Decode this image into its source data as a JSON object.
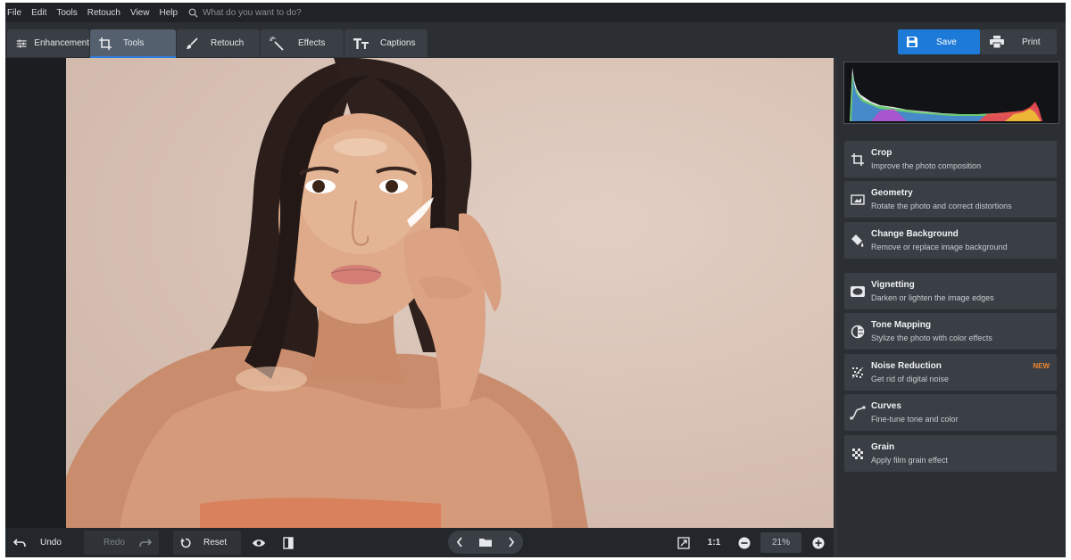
{
  "menu": {
    "items": [
      "File",
      "Edit",
      "Tools",
      "Retouch",
      "View",
      "Help"
    ],
    "search_placeholder": "What do you want to do?"
  },
  "toolbar": {
    "tabs": [
      {
        "label": "Enhancement",
        "icon": "sliders-icon"
      },
      {
        "label": "Tools",
        "icon": "crop-icon",
        "active": true
      },
      {
        "label": "Retouch",
        "icon": "brush-icon"
      },
      {
        "label": "Effects",
        "icon": "magic-wand-icon"
      },
      {
        "label": "Captions",
        "icon": "text-icon"
      }
    ],
    "save_label": "Save",
    "print_label": "Print"
  },
  "tools": [
    {
      "title": "Crop",
      "desc": "Improve the photo composition",
      "icon": "crop-icon"
    },
    {
      "title": "Geometry",
      "desc": "Rotate the photo and correct distortions",
      "icon": "geometry-icon"
    },
    {
      "title": "Change Background",
      "desc": "Remove or replace image background",
      "icon": "paint-bucket-icon"
    },
    {
      "title": "Vignetting",
      "desc": "Darken or lighten the image edges",
      "icon": "vignette-icon"
    },
    {
      "title": "Tone Mapping",
      "desc": "Stylize the photo with color effects",
      "icon": "tone-mapping-icon"
    },
    {
      "title": "Noise Reduction",
      "desc": "Get rid of digital noise",
      "icon": "noise-icon",
      "badge": "NEW"
    },
    {
      "title": "Curves",
      "desc": "Fine-tune tone and color",
      "icon": "curves-icon"
    },
    {
      "title": "Grain",
      "desc": "Apply film grain effect",
      "icon": "grain-icon"
    }
  ],
  "bottom": {
    "undo_label": "Undo",
    "redo_label": "Redo",
    "reset_label": "Reset",
    "ratio_label": "1:1",
    "zoom_value": "21%"
  },
  "colors": {
    "accent": "#1d7ad8",
    "badge": "#f0862e",
    "panel_bg": "#2b2f34",
    "card_bg": "#3a3f45"
  }
}
